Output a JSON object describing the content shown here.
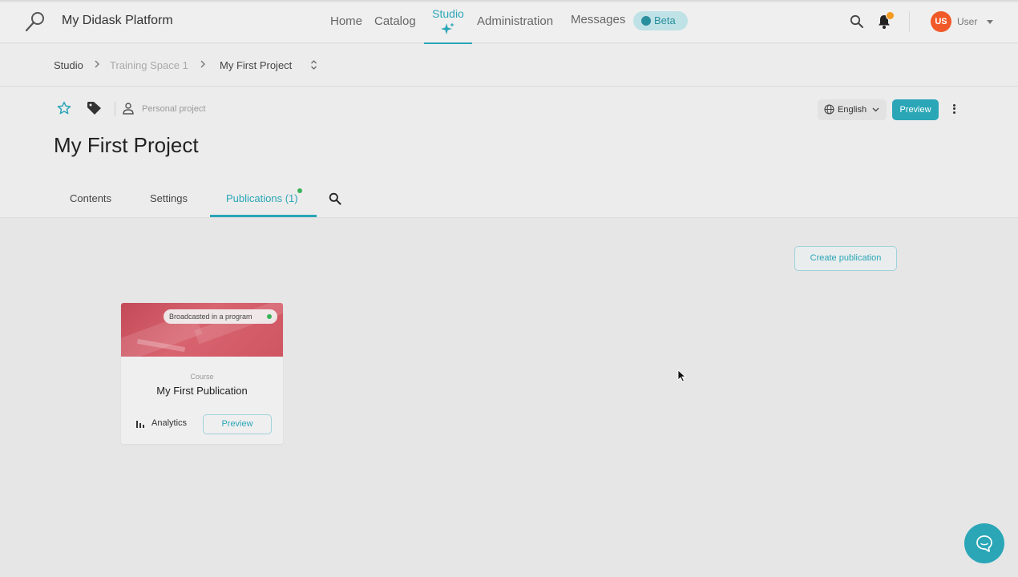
{
  "app": {
    "title": "My Didask Platform"
  },
  "nav": {
    "home": "Home",
    "catalog": "Catalog",
    "studio": "Studio",
    "administration": "Administration",
    "messages": "Messages",
    "beta": "Beta"
  },
  "user": {
    "initials": "US",
    "name": "User"
  },
  "breadcrumb": {
    "studio": "Studio",
    "training_space": "Training Space 1",
    "project": "My First Project"
  },
  "project": {
    "ownership": "Personal project",
    "title": "My First Project",
    "language": "English",
    "preview_label": "Preview"
  },
  "tabs": {
    "contents": "Contents",
    "settings": "Settings",
    "publications": "Publications (1)"
  },
  "main": {
    "create_publication": "Create publication"
  },
  "publication_card": {
    "badge": "Broadcasted in a program",
    "type": "Course",
    "title": "My First Publication",
    "analytics": "Analytics",
    "preview": "Preview"
  },
  "colors": {
    "accent": "#2aa6b7",
    "avatar": "#f05a28",
    "notification": "#f39a1f",
    "status_ok": "#3bb35a",
    "card_cover": "#c44a58"
  }
}
